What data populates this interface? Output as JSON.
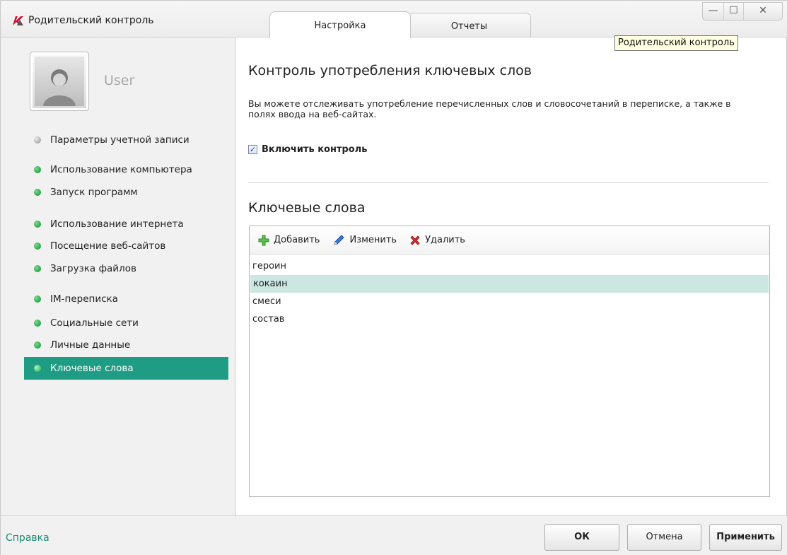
{
  "window": {
    "title": "Родительский контроль",
    "tooltip": "Родительский контроль",
    "controls": {
      "minimize": "—",
      "maximize": "☐",
      "close": "✕"
    }
  },
  "tabs": [
    {
      "label": "Настройка",
      "active": true
    },
    {
      "label": "Отчеты",
      "active": false
    }
  ],
  "user": {
    "name": "User"
  },
  "sidebar": {
    "items": [
      {
        "label": "Параметры учетной записи",
        "status": "gray"
      },
      {
        "label": "Использование компьютера",
        "status": "green"
      },
      {
        "label": "Запуск программ",
        "status": "green"
      },
      {
        "label": "Использование интернета",
        "status": "green"
      },
      {
        "label": "Посещение веб-сайтов",
        "status": "green"
      },
      {
        "label": "Загрузка файлов",
        "status": "green"
      },
      {
        "label": "IM-переписка",
        "status": "green"
      },
      {
        "label": "Социальные сети",
        "status": "green"
      },
      {
        "label": "Личные данные",
        "status": "green"
      },
      {
        "label": "Ключевые слова",
        "status": "green",
        "active": true
      }
    ]
  },
  "main": {
    "title": "Контроль употребления ключевых слов",
    "description": "Вы можете отслеживать употребление перечисленных слов и словосочетаний в переписке, а также в полях ввода на веб-сайтах.",
    "enable_checkbox": {
      "label": "Включить контроль",
      "checked": true
    },
    "keywords_title": "Ключевые слова",
    "toolbar": {
      "add": "Добавить",
      "edit": "Изменить",
      "delete": "Удалить"
    },
    "keywords": [
      {
        "text": "героин",
        "selected": false
      },
      {
        "text": "кокаин",
        "selected": true
      },
      {
        "text": "смеси",
        "selected": false
      },
      {
        "text": "состав",
        "selected": false
      }
    ]
  },
  "footer": {
    "help": "Справка",
    "ok": "ОК",
    "cancel": "Отмена",
    "apply": "Применить"
  },
  "colors": {
    "accent": "#1f9c84",
    "selected_row": "#cce6e1",
    "status_green": "#27a64a",
    "status_gray": "#a9a9a9",
    "help_link": "#1f8a74"
  }
}
